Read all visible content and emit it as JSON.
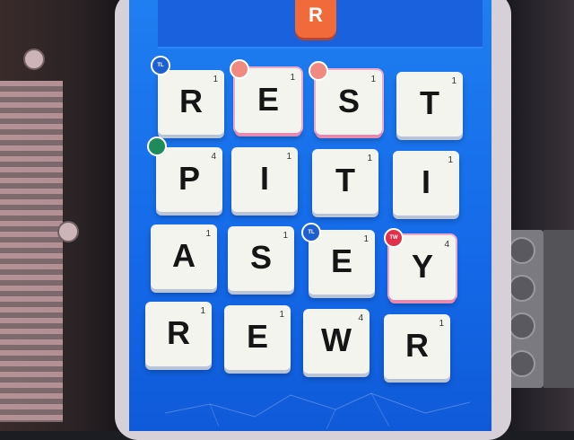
{
  "game": {
    "target_letter": "R",
    "tiles": [
      {
        "letter": "R",
        "score": "1"
      },
      {
        "letter": "E",
        "score": "1"
      },
      {
        "letter": "S",
        "score": "1"
      },
      {
        "letter": "T",
        "score": "1"
      },
      {
        "letter": "P",
        "score": "4"
      },
      {
        "letter": "I",
        "score": "1"
      },
      {
        "letter": "T",
        "score": "1"
      },
      {
        "letter": "I",
        "score": "1"
      },
      {
        "letter": "A",
        "score": "1"
      },
      {
        "letter": "S",
        "score": "1"
      },
      {
        "letter": "E",
        "score": "1"
      },
      {
        "letter": "Y",
        "score": "4"
      },
      {
        "letter": "R",
        "score": "1"
      },
      {
        "letter": "E",
        "score": "1"
      },
      {
        "letter": "W",
        "score": "4"
      },
      {
        "letter": "R",
        "score": "1"
      }
    ],
    "modifiers": [
      {
        "label": "TL",
        "color": "#1d5fd0"
      },
      {
        "label": "",
        "color": "#f08a80"
      },
      {
        "label": "",
        "color": "#f08a80"
      },
      {
        "label": "",
        "color": "#1f8a5a"
      },
      {
        "label": "TL",
        "color": "#1d5fd0"
      },
      {
        "label": "TW",
        "color": "#e0304a"
      }
    ]
  }
}
